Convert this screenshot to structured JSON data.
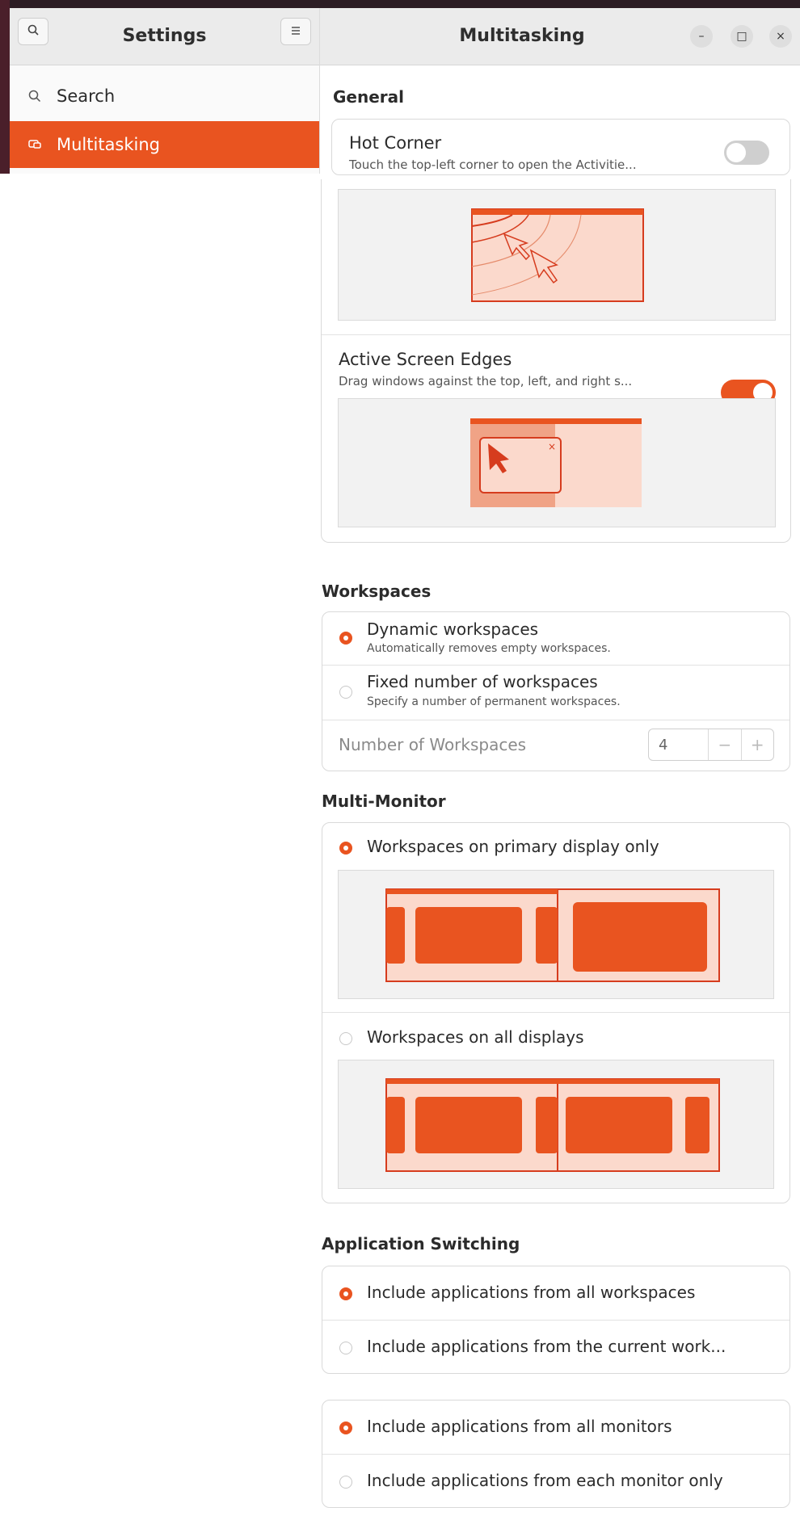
{
  "sidebar": {
    "title": "Settings",
    "search_icon": "search-icon",
    "menu_icon": "hamburger-menu-icon",
    "items": [
      {
        "label": "Search",
        "icon": "search-icon"
      },
      {
        "label": "Multitasking",
        "icon": "multitasking-icon",
        "active": true
      }
    ]
  },
  "header": {
    "title": "Multitasking",
    "minimize_glyph": "–",
    "maximize_glyph": "□",
    "close_glyph": "×"
  },
  "general": {
    "title": "General",
    "hot_corner": {
      "title": "Hot Corner",
      "subtitle": "Touch the top-left corner to open the Activitie...",
      "enabled": false
    },
    "active_edges": {
      "title": "Active Screen Edges",
      "subtitle": "Drag windows against the top, left, and right s...",
      "enabled": true
    }
  },
  "workspaces": {
    "title": "Workspaces",
    "options": [
      {
        "title": "Dynamic workspaces",
        "subtitle": "Automatically removes empty workspaces.",
        "selected": true
      },
      {
        "title": "Fixed number of workspaces",
        "subtitle": "Specify a number of permanent workspaces.",
        "selected": false
      }
    ],
    "number_label": "Number of Workspaces",
    "number_value": "4",
    "minus": "−",
    "plus": "+"
  },
  "multi_monitor": {
    "title": "Multi-Monitor",
    "options": [
      {
        "title": "Workspaces on primary display only",
        "selected": true
      },
      {
        "title": "Workspaces on all displays",
        "selected": false
      }
    ]
  },
  "app_switching": {
    "title": "Application Switching",
    "group1": [
      {
        "title": "Include applications from all workspaces",
        "selected": true
      },
      {
        "title": "Include applications from the current work...",
        "selected": false
      }
    ],
    "group2": [
      {
        "title": "Include applications from all monitors",
        "selected": true
      },
      {
        "title": "Include applications from each monitor only",
        "selected": false
      }
    ]
  },
  "colors": {
    "accent": "#e95420",
    "accent_light": "#fbd9cc",
    "accent_dark": "#c7381a"
  }
}
